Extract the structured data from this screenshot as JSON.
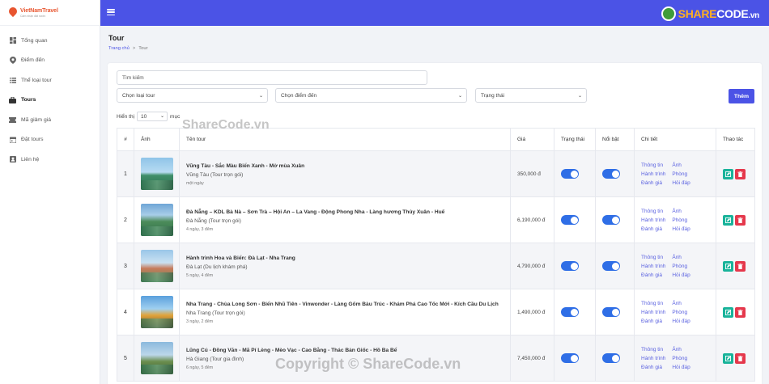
{
  "brand": {
    "name": "VietNamTravel",
    "tagline": "Cảm nhận đất nước"
  },
  "sidebar": {
    "items": [
      {
        "label": "Tổng quan",
        "icon": "dashboard-icon"
      },
      {
        "label": "Điểm đến",
        "icon": "map-pin-icon"
      },
      {
        "label": "Thể loại tour",
        "icon": "list-icon"
      },
      {
        "label": "Tours",
        "icon": "briefcase-icon",
        "active": true
      },
      {
        "label": "Mã giảm giá",
        "icon": "ticket-icon"
      },
      {
        "label": "Đặt tours",
        "icon": "calendar-icon"
      },
      {
        "label": "Liên hệ",
        "icon": "contact-icon"
      }
    ]
  },
  "header": {
    "title": "Tour",
    "breadcrumb": [
      "Trang chủ",
      "Tour"
    ],
    "breadcrumb_sep": ">"
  },
  "filters": {
    "search_placeholder": "Tìm kiếm",
    "category_select": "Chọn loại tour",
    "destination_select": "Chọn điểm đến",
    "status_select": "Trạng thái",
    "add_button": "Thêm",
    "show_label": "Hiển thị",
    "show_value": "10",
    "entries_label": "mục"
  },
  "table": {
    "headers": [
      "#",
      "Ảnh",
      "Tên tour",
      "Giá",
      "Trạng thái",
      "Nổi bật",
      "Chi tiết",
      "Thao tác"
    ],
    "detail_links": [
      "Thông tin",
      "Ảnh",
      "Hành trình",
      "Phòng",
      "Đánh giá",
      "Hỏi đáp"
    ],
    "rows": [
      {
        "num": "1",
        "name": "Vũng Tàu - Sắc Màu Biển Xanh - Mở mùa Xuân",
        "category": "Vũng Tàu (Tour trọn gói)",
        "duration": "một ngày",
        "price": "350,000 đ",
        "status_on": true,
        "featured_on": true
      },
      {
        "num": "2",
        "name": "Đà Nẵng – KDL Bà Nà – Sơn Trà – Hội An – La Vang - Động Phong Nha - Làng hương Thủy Xuân - Huế",
        "category": "Đà Nẵng (Tour trọn gói)",
        "duration": "4 ngày, 3 đêm",
        "price": "6,190,000 đ",
        "status_on": true,
        "featured_on": true
      },
      {
        "num": "3",
        "name": "Hành trình Hoa và Biển: Đà Lạt - Nha Trang",
        "category": "Đà Lạt (Du lịch khám phá)",
        "duration": "5 ngày, 4 đêm",
        "price": "4,790,000 đ",
        "status_on": true,
        "featured_on": true
      },
      {
        "num": "4",
        "name": "Nha Trang - Chùa Long Sơn - Biển Nhũ Tiên - Vinwonder - Làng Gốm Bàu Trúc - Khám Phá Cao Tốc Mới - Kích Cầu Du Lịch",
        "category": "Nha Trang (Tour trọn gói)",
        "duration": "3 ngày, 2 đêm",
        "price": "1,490,000 đ",
        "status_on": true,
        "featured_on": true
      },
      {
        "num": "5",
        "name": "Lũng Cú - Đồng Văn - Mã Pí Lèng - Mèo Vạc - Cao Bằng - Thác Bản Giốc - Hồ Ba Bể",
        "category": "Hà Giang (Tour gia đình)",
        "duration": "6 ngày, 5 đêm",
        "price": "7,450,000 đ",
        "status_on": true,
        "featured_on": true
      }
    ]
  },
  "watermarks": {
    "center": "ShareCode.vn",
    "bottom": "Copyright © ShareCode.vn",
    "logo_share": "SHARE",
    "logo_code": "CODE",
    "logo_tld": ".vn"
  },
  "colors": {
    "primary": "#4b53e6",
    "toggle": "#2f6ee6",
    "edit": "#19b39a",
    "delete": "#e5384c",
    "brand": "#e8552f"
  }
}
